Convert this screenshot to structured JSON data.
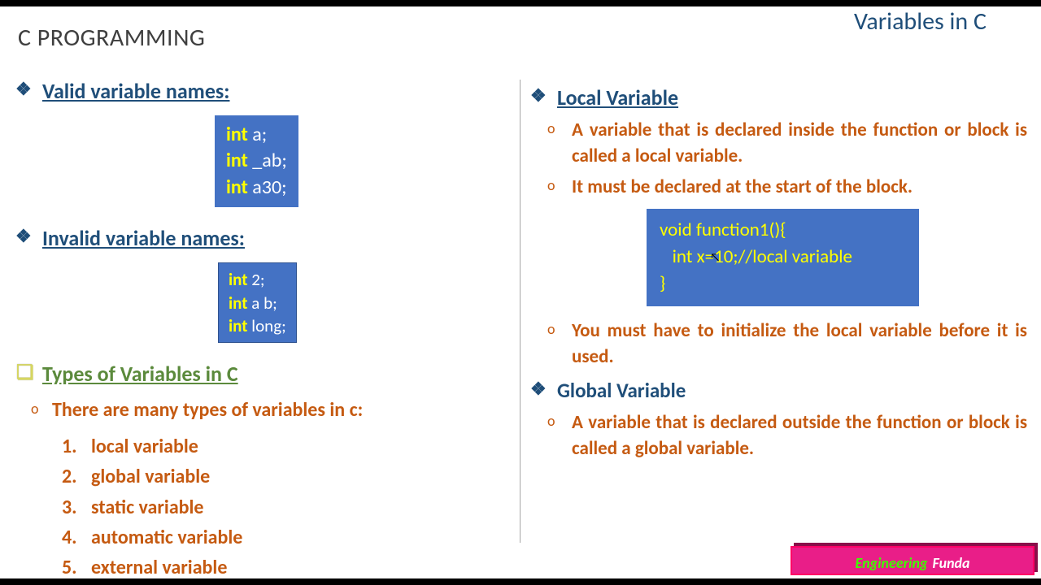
{
  "header": {
    "title": "C PROGRAMMING",
    "subtitle": "Variables in C"
  },
  "left": {
    "valid_heading": "Valid variable names:",
    "valid_code": {
      "l1_kw": "int",
      "l1_id": " a;",
      "l2_kw": "int",
      "l2_id": " _ab;",
      "l3_kw": "int",
      "l3_id": " a30;"
    },
    "invalid_heading": "Invalid variable names:",
    "invalid_code": {
      "l1_kw": "int",
      "l1_id": " 2;",
      "l2_kw": "int",
      "l2_id": " a b;",
      "l3_kw": "int",
      "l3_id": " long;"
    },
    "types_heading": "Types of Variables in C",
    "types_intro": "There are many types of variables in c:",
    "types_list": {
      "i1": "local variable",
      "i2": "global variable",
      "i3": "static variable",
      "i4": "automatic variable",
      "i5": "external variable"
    }
  },
  "right": {
    "local_heading": "Local Variable",
    "local_desc1": "A variable that is declared inside the function or block is called a local variable.",
    "local_desc2": "It must be declared at the start of the block.",
    "local_code_l1": "void function1(){",
    "local_code_l2": "   int x=10;//local variable",
    "local_code_l3": "}",
    "local_desc3": "You must have to initialize the local variable before it is used.",
    "global_heading": "Global Variable",
    "global_desc1": "A variable that is declared outside the function or block is called a global variable."
  },
  "watermark": {
    "w1": "Engineering",
    "w2": "Funda"
  }
}
